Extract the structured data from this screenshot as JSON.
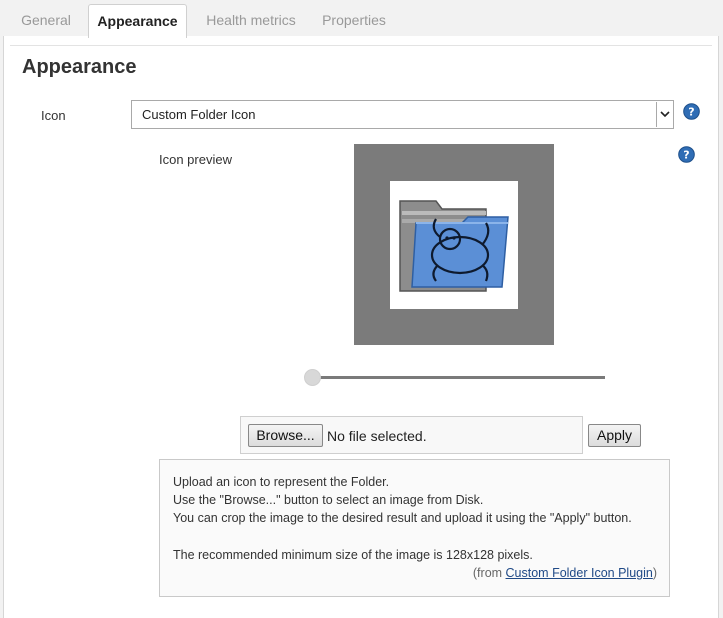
{
  "tabs": [
    {
      "label": "General",
      "active": false
    },
    {
      "label": "Appearance",
      "active": true
    },
    {
      "label": "Health metrics",
      "active": false
    },
    {
      "label": "Properties",
      "active": false
    }
  ],
  "section": {
    "title": "Appearance"
  },
  "icon_field": {
    "label": "Icon",
    "selected": "Custom Folder Icon"
  },
  "preview": {
    "label": "Icon preview"
  },
  "zoom_slider": {
    "value": 0
  },
  "file_upload": {
    "browse_label": "Browse...",
    "status": "No file selected.",
    "apply_label": "Apply"
  },
  "info": {
    "lines": [
      "Upload an icon to represent the Folder.",
      "Use the \"Browse...\" button to select an image from Disk.",
      "You can crop the image to the desired result and upload it using the \"Apply\" button.",
      "The recommended minimum size of the image is 128x128 pixels."
    ],
    "credit_prefix": "(from ",
    "credit_link": "Custom Folder Icon Plugin",
    "credit_suffix": ")"
  },
  "icons": {
    "help": "help-icon",
    "dropdown": "chevron-down-icon",
    "preview_image": "folder-sloth-icon"
  },
  "colors": {
    "help_icon": "#2f6db5",
    "link": "#204a87",
    "preview_bg": "#7b7b7b",
    "folder_blue": "#5b8fd6"
  }
}
